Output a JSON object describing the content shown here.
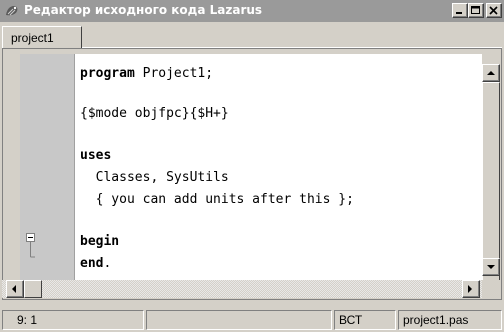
{
  "window": {
    "title": "Редактор исходного кода Lazarus",
    "icon": "lazarus-app-icon",
    "controls": {
      "minimize": "minimize-icon",
      "maximize": "maximize-icon",
      "close": "close-icon"
    }
  },
  "tabs": [
    {
      "label": "project1",
      "active": true
    }
  ],
  "editor": {
    "lines": [
      {
        "keyword": "program",
        "rest": " Project1;"
      },
      {
        "keyword": "",
        "rest": ""
      },
      {
        "keyword": "",
        "rest": "{$mode objfpc}{$H+}"
      },
      {
        "keyword": "",
        "rest": ""
      },
      {
        "keyword": "uses",
        "rest": ""
      },
      {
        "keyword": "",
        "rest": "  Classes, SysUtils"
      },
      {
        "keyword": "",
        "rest": "  { you can add units after this };"
      },
      {
        "keyword": "",
        "rest": ""
      },
      {
        "keyword": "begin",
        "rest": ""
      },
      {
        "keyword": "end",
        "rest": "."
      }
    ]
  },
  "statusbar": {
    "position": "9:  1",
    "modified": "",
    "mode": "ВСТ",
    "filename": "project1.pas"
  },
  "colors": {
    "titlebar": "#9a9a9a",
    "chrome": "#d4d0c8",
    "gutter": "#c8c8c8"
  }
}
